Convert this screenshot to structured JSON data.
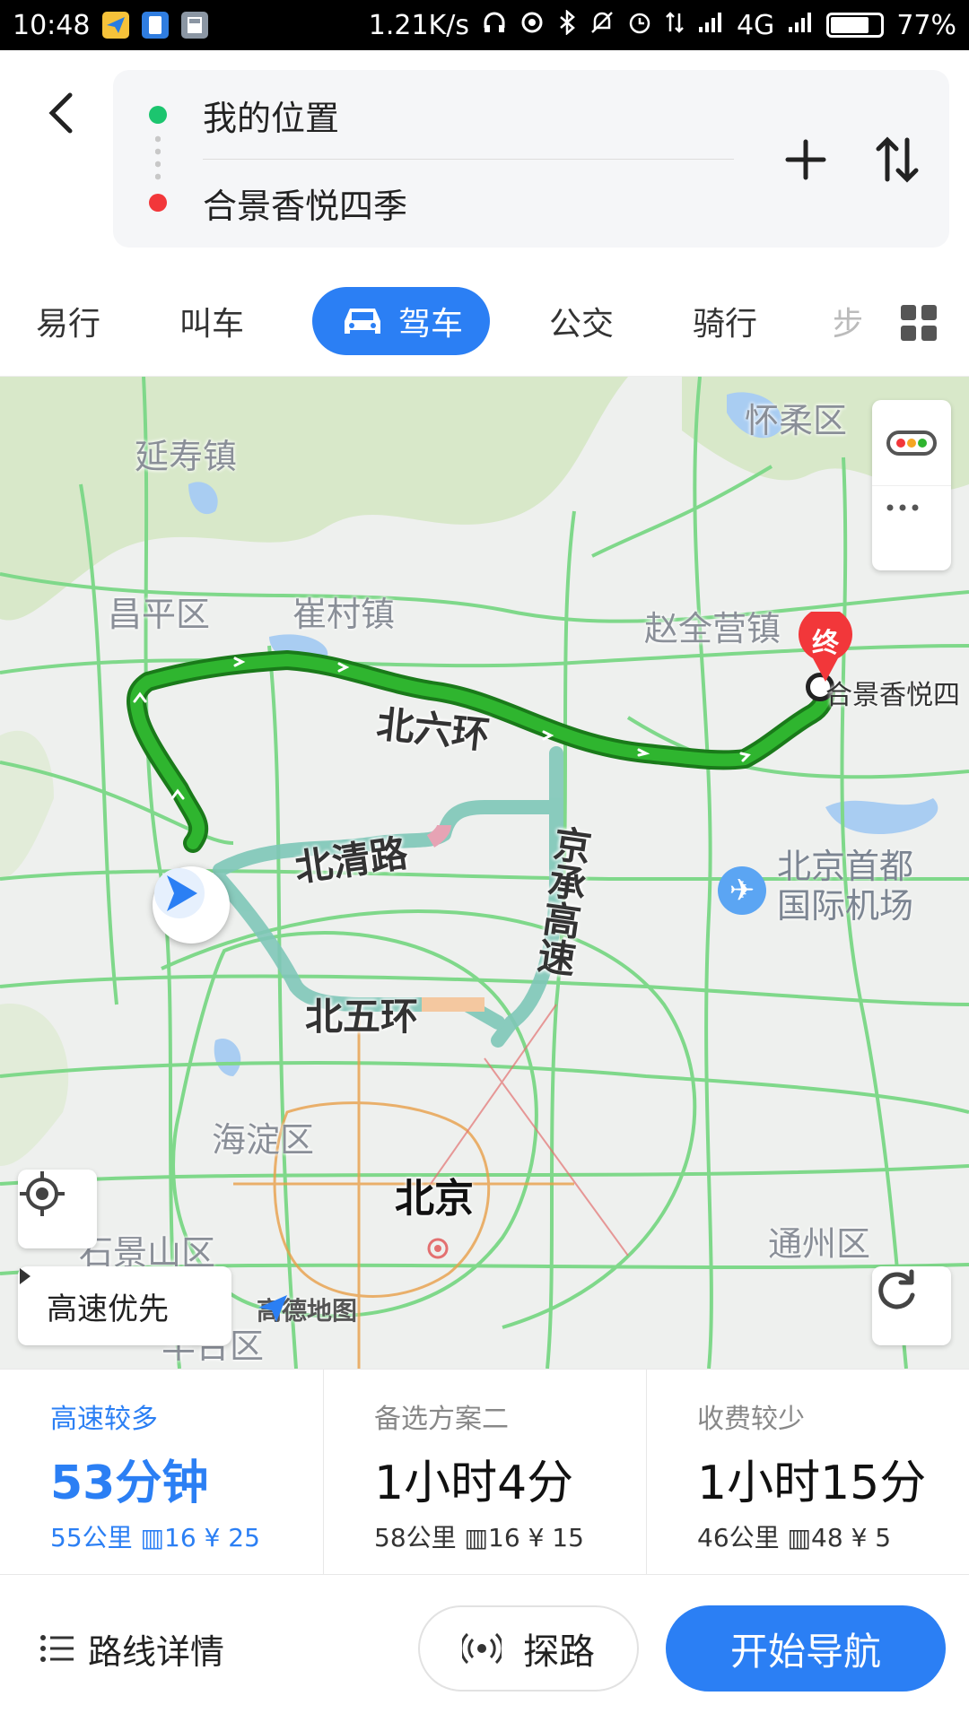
{
  "status_bar": {
    "time": "10:48",
    "network_speed": "1.21K/s",
    "network_type": "4G",
    "battery": "77%",
    "battery_level": 0.77,
    "icons": [
      "send-icon",
      "file-icon",
      "calculator-icon",
      "headphones-icon",
      "hotspot-icon",
      "bluetooth-icon",
      "mute-icon",
      "alarm-icon",
      "data-arrows-icon",
      "signal-icon",
      "signal-icon"
    ]
  },
  "route": {
    "start": "我的位置",
    "end": "合景香悦四季",
    "start_dot_color": "#1cc56f",
    "end_dot_color": "#f2373a"
  },
  "tabs": [
    {
      "label": "易行",
      "icon": null
    },
    {
      "label": "叫车",
      "icon": null
    },
    {
      "label": "驾车",
      "icon": "car-icon",
      "active": true
    },
    {
      "label": "公交",
      "icon": null
    },
    {
      "label": "骑行",
      "icon": null
    },
    {
      "label": "步",
      "icon": null
    }
  ],
  "accent_color": "#2b7ff4",
  "map": {
    "places": [
      "怀柔区",
      "延寿镇",
      "昌平区",
      "崔村镇",
      "赵全营镇",
      "海淀区",
      "北京",
      "通州区",
      "石景山区",
      "丰台区"
    ],
    "roads": [
      "北六环",
      "北清路",
      "京承高速",
      "北五环"
    ],
    "airport": [
      "北京首都",
      "国际机场"
    ],
    "destination_label": "合景香悦四",
    "end_marker_text": "终",
    "route_pref": "高速优先",
    "logo": "高德地图"
  },
  "options": [
    {
      "tag": "高速较多",
      "time": "53分钟",
      "distance": "55公里",
      "lights": "16",
      "toll": "¥ 25",
      "selected": true
    },
    {
      "tag": "备选方案二",
      "time": "1小时4分",
      "distance": "58公里",
      "lights": "16",
      "toll": "¥ 15",
      "selected": false
    },
    {
      "tag": "收费较少",
      "time": "1小时15分",
      "distance": "46公里",
      "lights": "48",
      "toll": "¥ 5",
      "selected": false
    }
  ],
  "actions": {
    "details": "路线详情",
    "explore": "探路",
    "start_nav": "开始导航"
  }
}
